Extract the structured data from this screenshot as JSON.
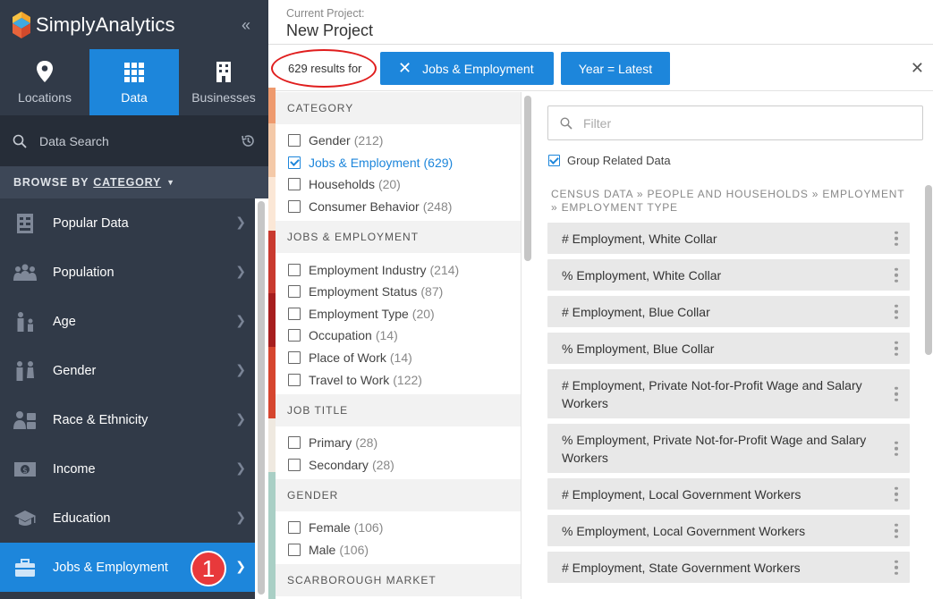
{
  "app": {
    "name": "SimplyAnalytics"
  },
  "sidebar": {
    "tabs": [
      {
        "label": "Locations",
        "icon": "map-pin-icon",
        "active": false
      },
      {
        "label": "Data",
        "icon": "grid-icon",
        "active": true
      },
      {
        "label": "Businesses",
        "icon": "building-icon",
        "active": false
      }
    ],
    "search_placeholder": "Data Search",
    "browse_by": "BROWSE BY",
    "browse_mode": "CATEGORY",
    "categories": [
      {
        "label": "Popular Data",
        "icon": "popular-data-icon"
      },
      {
        "label": "Population",
        "icon": "population-icon"
      },
      {
        "label": "Age",
        "icon": "age-icon"
      },
      {
        "label": "Gender",
        "icon": "gender-icon"
      },
      {
        "label": "Race & Ethnicity",
        "icon": "race-ethnicity-icon"
      },
      {
        "label": "Income",
        "icon": "income-icon"
      },
      {
        "label": "Education",
        "icon": "graduation-cap-icon"
      },
      {
        "label": "Jobs & Employment",
        "icon": "briefcase-icon",
        "active": true,
        "badge": "1"
      }
    ]
  },
  "header": {
    "label": "Current Project:",
    "project_name": "New Project"
  },
  "results": {
    "count_text": "629 results for",
    "chips": [
      {
        "label": "Jobs & Employment",
        "removable": true
      },
      {
        "label": "Year = Latest",
        "removable": false
      }
    ]
  },
  "facets": [
    {
      "title": "CATEGORY",
      "items": [
        {
          "name": "Gender",
          "count": "(212)",
          "checked": false
        },
        {
          "name": "Jobs & Employment",
          "count": "(629)",
          "checked": true
        },
        {
          "name": "Households",
          "count": "(20)",
          "checked": false
        },
        {
          "name": "Consumer Behavior",
          "count": "(248)",
          "checked": false
        }
      ]
    },
    {
      "title": "JOBS & EMPLOYMENT",
      "items": [
        {
          "name": "Employment Industry",
          "count": "(214)",
          "checked": false
        },
        {
          "name": "Employment Status",
          "count": "(87)",
          "checked": false
        },
        {
          "name": "Employment Type",
          "count": "(20)",
          "checked": false
        },
        {
          "name": "Occupation",
          "count": "(14)",
          "checked": false
        },
        {
          "name": "Place of Work",
          "count": "(14)",
          "checked": false
        },
        {
          "name": "Travel to Work",
          "count": "(122)",
          "checked": false
        }
      ]
    },
    {
      "title": "JOB TITLE",
      "items": [
        {
          "name": "Primary",
          "count": "(28)",
          "checked": false
        },
        {
          "name": "Secondary",
          "count": "(28)",
          "checked": false
        }
      ]
    },
    {
      "title": "GENDER",
      "items": [
        {
          "name": "Female",
          "count": "(106)",
          "checked": false
        },
        {
          "name": "Male",
          "count": "(106)",
          "checked": false
        }
      ]
    },
    {
      "title": "SCARBOROUGH MARKET",
      "items": []
    }
  ],
  "filter": {
    "placeholder": "Filter"
  },
  "group_related": {
    "label": "Group Related Data",
    "checked": true
  },
  "breadcrumb": "CENSUS DATA » PEOPLE AND HOUSEHOLDS » EMPLOYMENT » EMPLOYMENT TYPE",
  "variables": [
    "# Employment, White Collar",
    "% Employment, White Collar",
    "# Employment, Blue Collar",
    "% Employment, Blue Collar",
    "# Employment, Private Not-for-Profit Wage and Salary Workers",
    "% Employment, Private Not-for-Profit Wage and Salary Workers",
    "# Employment, Local Government Workers",
    "% Employment, Local Government Workers",
    "# Employment, State Government Workers"
  ],
  "colors": {
    "accent": "#1d86db",
    "sidebar": "#313a48",
    "badge": "#e8393b",
    "highlight": "#e01e1e"
  }
}
